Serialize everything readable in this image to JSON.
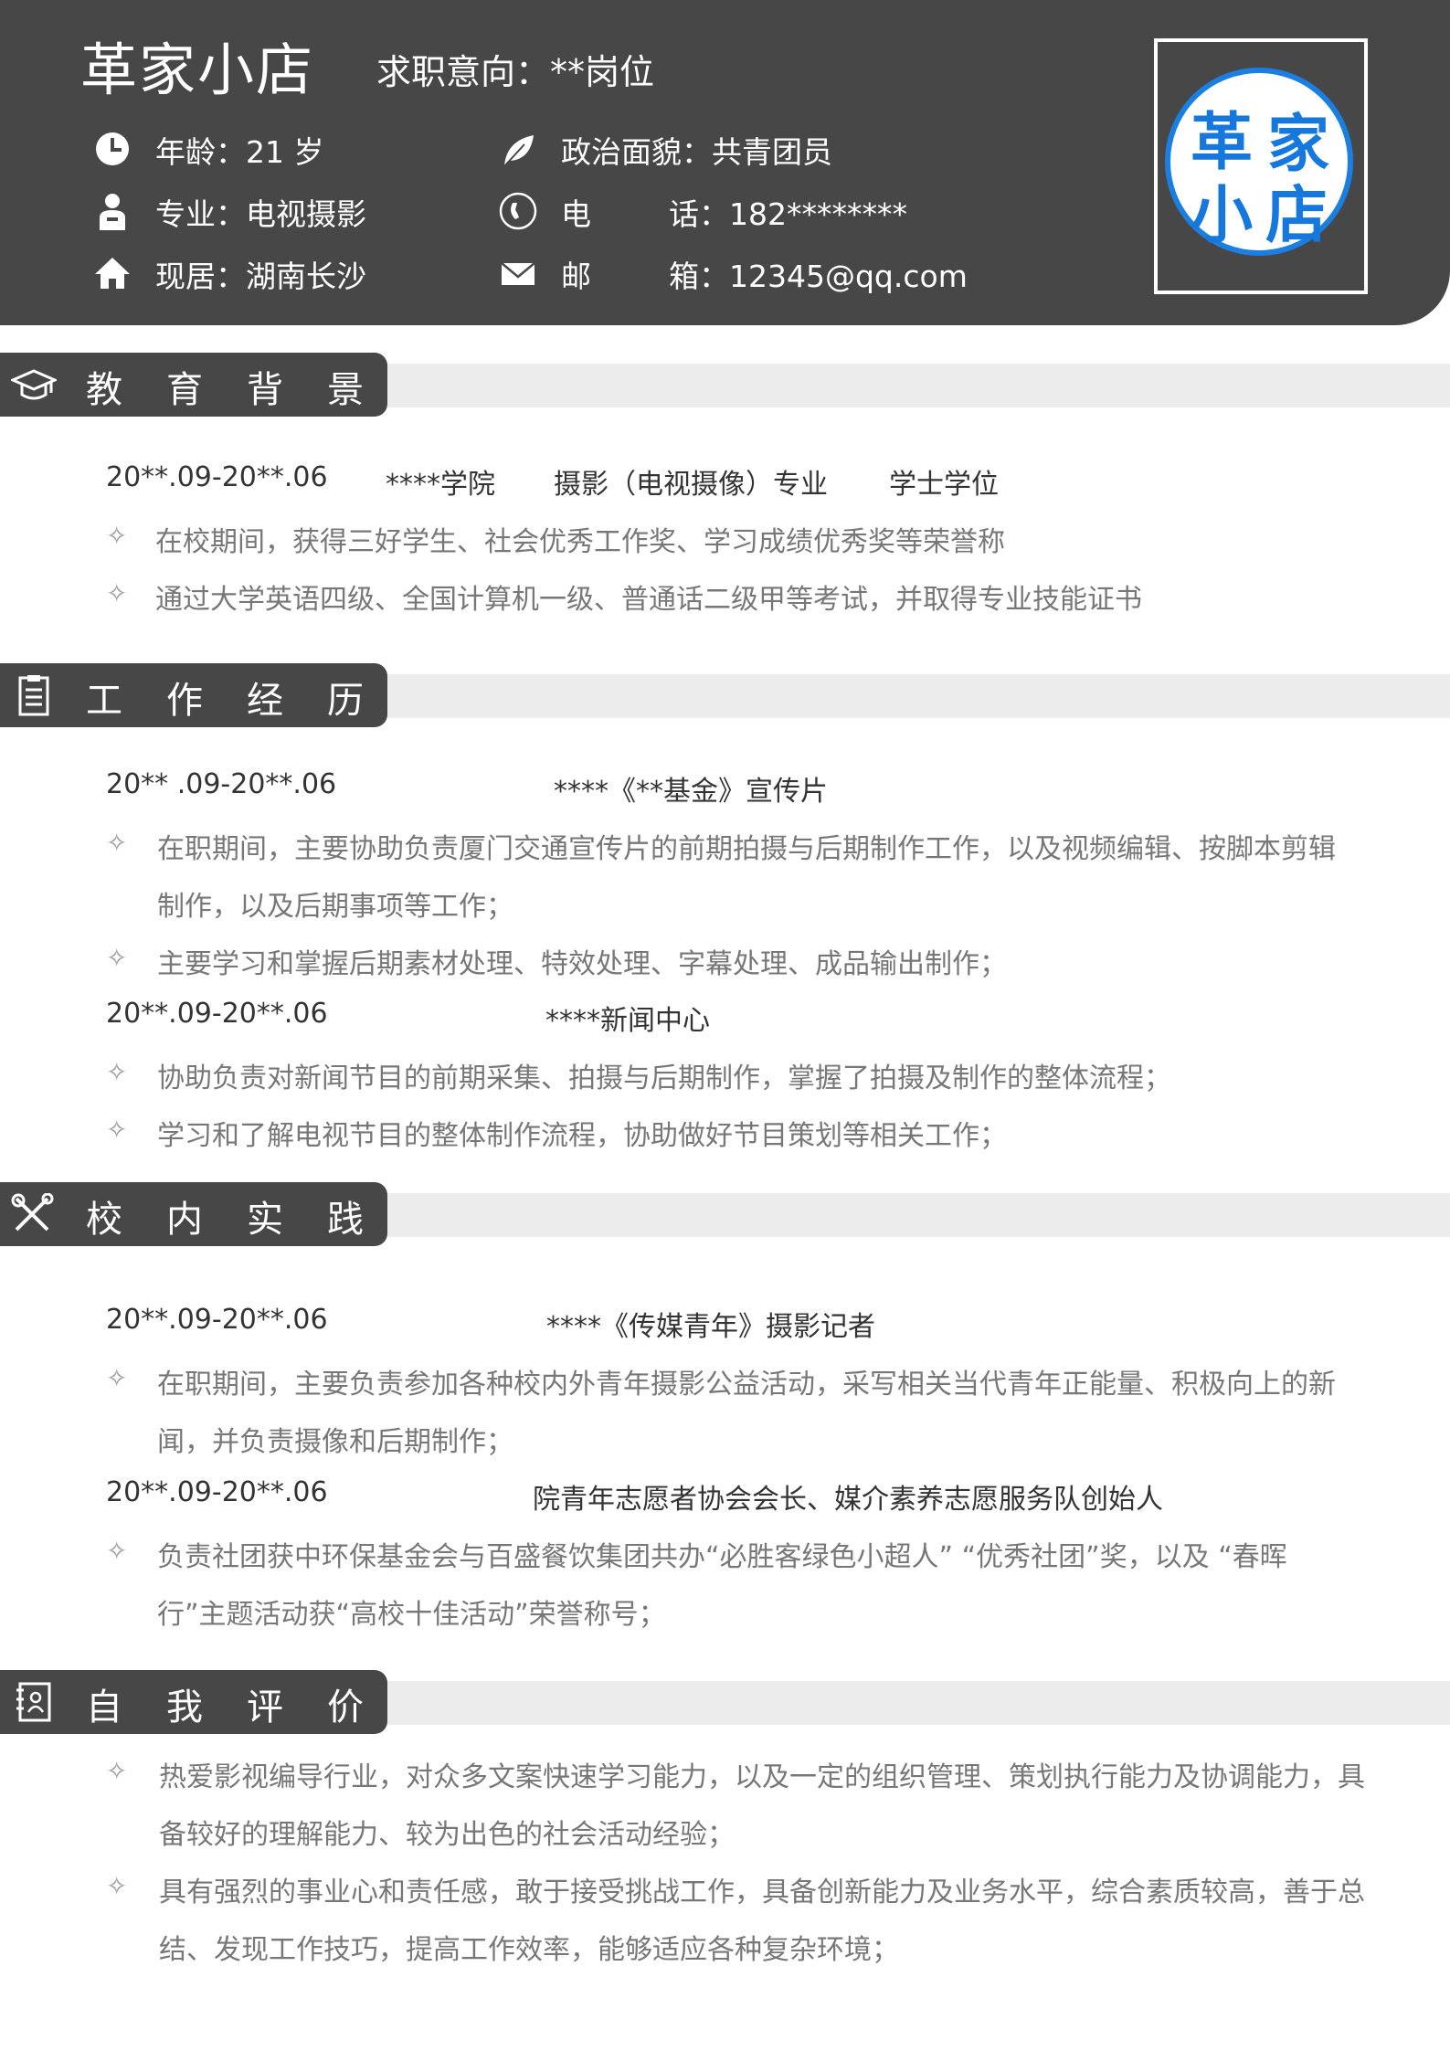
{
  "header": {
    "name": "革家小店",
    "intent": "求职意向：**岗位",
    "age": "年龄：21 岁",
    "major": "专业：电视摄影",
    "residence": "现居：湖南长沙",
    "politics": "政治面貌：共青团员",
    "phone_label": "电",
    "phone_value": "话：182********",
    "email_label": "邮",
    "email_value": "箱：12345@qq.com",
    "seal_chars": [
      "革",
      "家",
      "小",
      "店"
    ],
    "icons": [
      "clock-icon",
      "person-icon",
      "home-icon",
      "leaf-icon",
      "phone-icon",
      "mail-icon"
    ]
  },
  "sections": {
    "education": {
      "title": "教育背景",
      "date": "20**.09-20**.06",
      "school": "****学院",
      "major": "摄影（电视摄像）专业",
      "degree": "学士学位",
      "items": [
        "在校期间，获得三好学生、社会优秀工作奖、学习成绩优秀奖等荣誉称",
        "通过大学英语四级、全国计算机一级、普通话二级甲等考试，并取得专业技能证书"
      ]
    },
    "work": {
      "title": "工作经历",
      "job1_date": "20** .09-20**.06",
      "job1_org": "****《**基金》宣传片",
      "job1_items": [
        "在职期间，主要协助负责厦门交通宣传片的前期拍摄与后期制作工作，以及视频编辑、按脚本剪辑",
        "制作，以及后期事项等工作；",
        "主要学习和掌握后期素材处理、特效处理、字幕处理、成品输出制作；"
      ],
      "job2_date": "20**.09-20**.06",
      "job2_org": "****新闻中心",
      "job2_items": [
        "协助负责对新闻节目的前期采集、拍摄与后期制作，掌握了拍摄及制作的整体流程；",
        "学习和了解电视节目的整体制作流程，协助做好节目策划等相关工作；"
      ]
    },
    "campus": {
      "title": "校内实践",
      "p1_date": "20**.09-20**.06",
      "p1_org": "****《传媒青年》摄影记者",
      "p1_items": [
        "在职期间，主要负责参加各种校内外青年摄影公益活动，采写相关当代青年正能量、积极向上的新",
        "闻，并负责摄像和后期制作；"
      ],
      "p2_date": "20**.09-20**.06",
      "p2_org": "院青年志愿者协会会长、媒介素养志愿服务队创始人",
      "p2_items": [
        "负责社团获中环保基金会与百盛餐饮集团共办“必胜客绿色小超人” “优秀社团”奖，以及 “春晖",
        "行”主题活动获“高校十佳活动”荣誉称号；"
      ]
    },
    "self": {
      "title": "自我评价",
      "items": [
        "热爱影视编导行业，对众多文案快速学习能力，以及一定的组织管理、策划执行能力及协调能力，具",
        "备较好的理解能力、较为出色的社会活动经验；",
        "具有强烈的事业心和责任感，敢于接受挑战工作，具备创新能力及业务水平，综合素质较高，善于总",
        "结、发现工作技巧，提高工作效率，能够适应各种复杂环境；"
      ]
    }
  },
  "bullet": "✧",
  "colors": {
    "header_bg": "#474747",
    "band_bg": "#ececec",
    "seal_blue": "#1677dd",
    "body_text": "#777777"
  }
}
